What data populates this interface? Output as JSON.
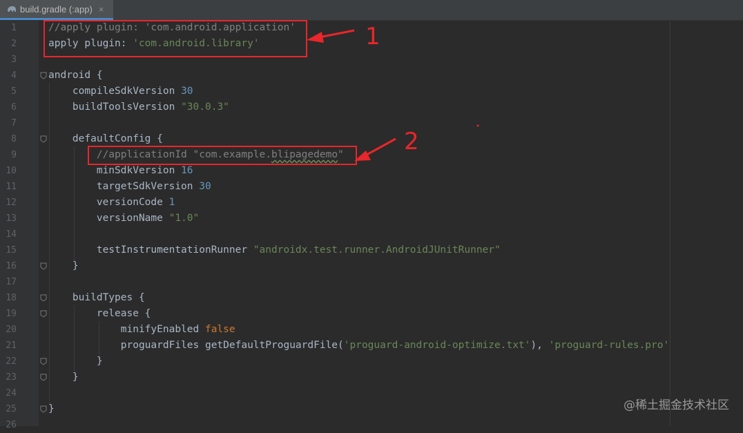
{
  "tab": {
    "title": "build.gradle (:app)",
    "close": "×",
    "icon": "gradle-elephant-icon"
  },
  "lines": [
    {
      "n": "1",
      "fold": false,
      "tokens": [
        {
          "t": "//apply plugin: 'com.android.application'",
          "c": "c-comment"
        }
      ]
    },
    {
      "n": "2",
      "fold": false,
      "tokens": [
        {
          "t": "apply plugin: ",
          "c": ""
        },
        {
          "t": "'com.android.library'",
          "c": "c-string"
        }
      ]
    },
    {
      "n": "3",
      "fold": false,
      "tokens": []
    },
    {
      "n": "4",
      "fold": true,
      "tokens": [
        {
          "t": "android {",
          "c": ""
        }
      ]
    },
    {
      "n": "5",
      "fold": false,
      "tokens": [
        {
          "t": "    compileSdkVersion ",
          "c": ""
        },
        {
          "t": "30",
          "c": "c-num"
        }
      ]
    },
    {
      "n": "6",
      "fold": false,
      "tokens": [
        {
          "t": "    buildToolsVersion ",
          "c": ""
        },
        {
          "t": "\"30.0.3\"",
          "c": "c-string"
        }
      ]
    },
    {
      "n": "7",
      "fold": false,
      "tokens": []
    },
    {
      "n": "8",
      "fold": true,
      "tokens": [
        {
          "t": "    defaultConfig {",
          "c": ""
        }
      ]
    },
    {
      "n": "9",
      "fold": false,
      "tokens": [
        {
          "t": "        //applicationId \"com.example.",
          "c": "c-comment"
        },
        {
          "t": "blipagedemo",
          "c": "c-comment squiggle"
        },
        {
          "t": "\"",
          "c": "c-comment"
        }
      ]
    },
    {
      "n": "10",
      "fold": false,
      "tokens": [
        {
          "t": "        minSdkVersion ",
          "c": ""
        },
        {
          "t": "16",
          "c": "c-num"
        }
      ]
    },
    {
      "n": "11",
      "fold": false,
      "tokens": [
        {
          "t": "        targetSdkVersion ",
          "c": ""
        },
        {
          "t": "30",
          "c": "c-num"
        }
      ]
    },
    {
      "n": "12",
      "fold": false,
      "tokens": [
        {
          "t": "        versionCode ",
          "c": ""
        },
        {
          "t": "1",
          "c": "c-num"
        }
      ]
    },
    {
      "n": "13",
      "fold": false,
      "tokens": [
        {
          "t": "        versionName ",
          "c": ""
        },
        {
          "t": "\"1.0\"",
          "c": "c-string"
        }
      ]
    },
    {
      "n": "14",
      "fold": false,
      "tokens": []
    },
    {
      "n": "15",
      "fold": false,
      "tokens": [
        {
          "t": "        testInstrumentationRunner ",
          "c": ""
        },
        {
          "t": "\"androidx.test.runner.AndroidJUnitRunner\"",
          "c": "c-string"
        }
      ]
    },
    {
      "n": "16",
      "fold": true,
      "tokens": [
        {
          "t": "    }",
          "c": ""
        }
      ]
    },
    {
      "n": "17",
      "fold": false,
      "tokens": []
    },
    {
      "n": "18",
      "fold": true,
      "tokens": [
        {
          "t": "    buildTypes {",
          "c": ""
        }
      ]
    },
    {
      "n": "19",
      "fold": true,
      "tokens": [
        {
          "t": "        release {",
          "c": ""
        }
      ]
    },
    {
      "n": "20",
      "fold": false,
      "tokens": [
        {
          "t": "            minifyEnabled ",
          "c": ""
        },
        {
          "t": "false",
          "c": "c-kw"
        }
      ]
    },
    {
      "n": "21",
      "fold": false,
      "tokens": [
        {
          "t": "            proguardFiles getDefaultProguardFile(",
          "c": ""
        },
        {
          "t": "'proguard-android-optimize.txt'",
          "c": "c-string"
        },
        {
          "t": "), ",
          "c": ""
        },
        {
          "t": "'proguard-rules.pro'",
          "c": "c-string"
        }
      ]
    },
    {
      "n": "22",
      "fold": true,
      "tokens": [
        {
          "t": "        }",
          "c": ""
        }
      ]
    },
    {
      "n": "23",
      "fold": true,
      "tokens": [
        {
          "t": "    }",
          "c": ""
        }
      ]
    },
    {
      "n": "24",
      "fold": false,
      "tokens": []
    },
    {
      "n": "25",
      "fold": true,
      "tokens": [
        {
          "t": "}",
          "c": ""
        }
      ]
    },
    {
      "n": "26",
      "fold": false,
      "tokens": []
    }
  ],
  "annotations": [
    {
      "label": "1",
      "target_line": "1"
    },
    {
      "label": "2",
      "target_line": "9"
    }
  ],
  "annotation_color": "#e8262b",
  "watermark": "@稀土掘金技术社区"
}
